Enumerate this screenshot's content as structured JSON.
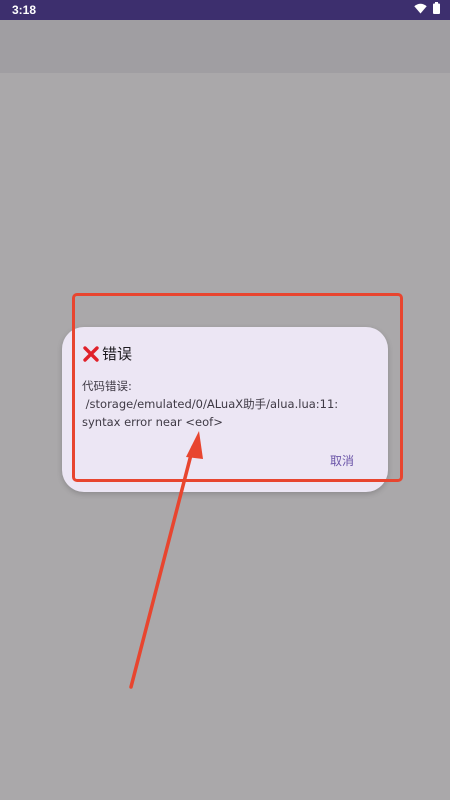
{
  "status_bar": {
    "time": "3:18",
    "icons": [
      "wifi-icon",
      "battery-icon"
    ]
  },
  "dialog": {
    "title": "错误",
    "title_icon": "x-icon",
    "message": "代码错误:\n /storage/emulated/0/ALuaX助手/alua.lua:11: syntax error near <eof>",
    "button_label": "取消"
  },
  "colors": {
    "status_bar_bg": "#3d2f6e",
    "dialog_bg": "#ece6f4",
    "accent": "#6b55a8",
    "annotation": "#e8452f",
    "error_icon": "#e0212a"
  }
}
